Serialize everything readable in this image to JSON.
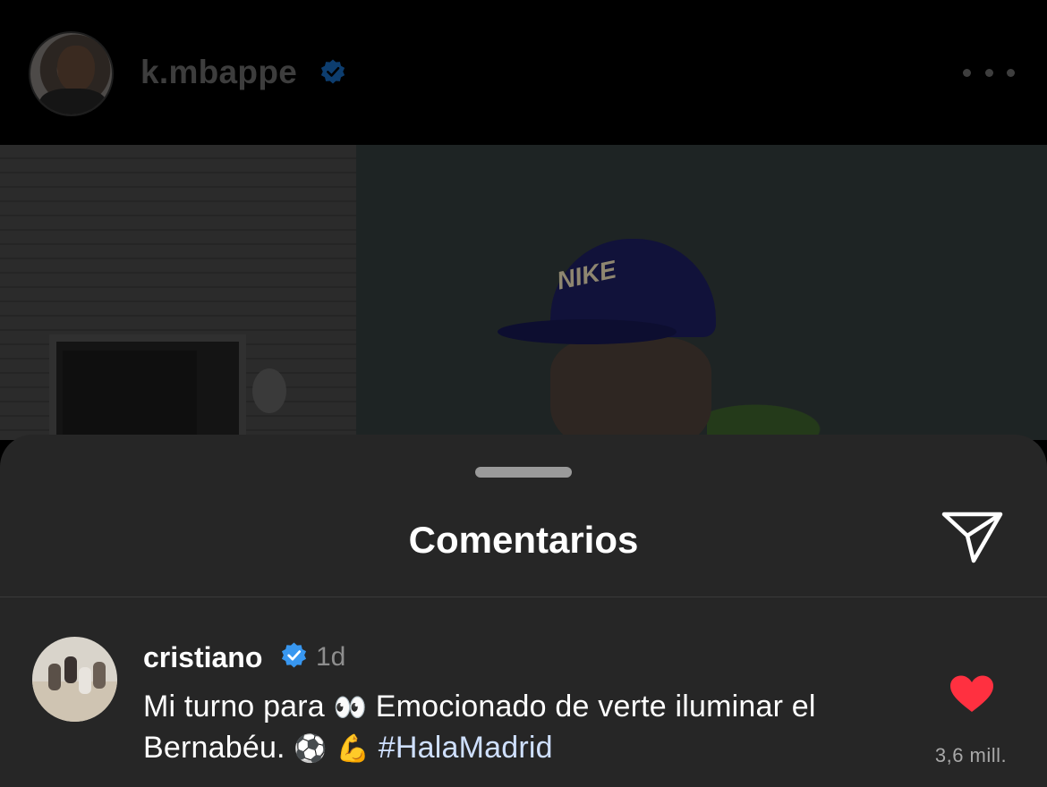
{
  "post": {
    "username": "k.mbappe",
    "verified_icon": "verified-badge-icon",
    "more_icon": "more-options-icon",
    "photo_cap_text": "NIKE"
  },
  "comments_sheet": {
    "title": "Comentarios",
    "share_icon": "paper-plane-icon",
    "comments": [
      {
        "username": "cristiano",
        "verified": true,
        "time": "1d",
        "text_part1": "Mi turno para ",
        "emoji_eyes": "👀",
        "text_part2": " Emocionado de verte iluminar el Bernabéu. ",
        "emoji_ball": "⚽",
        "emoji_muscle": "💪",
        "hashtag": "#HalaMadrid",
        "liked": true,
        "like_count": "3,6 mill."
      }
    ]
  },
  "colors": {
    "background": "#000000",
    "sheet": "#262626",
    "verified_blue": "#3897f0",
    "like_red": "#ff3040",
    "hashtag": "#cfe0ff"
  }
}
